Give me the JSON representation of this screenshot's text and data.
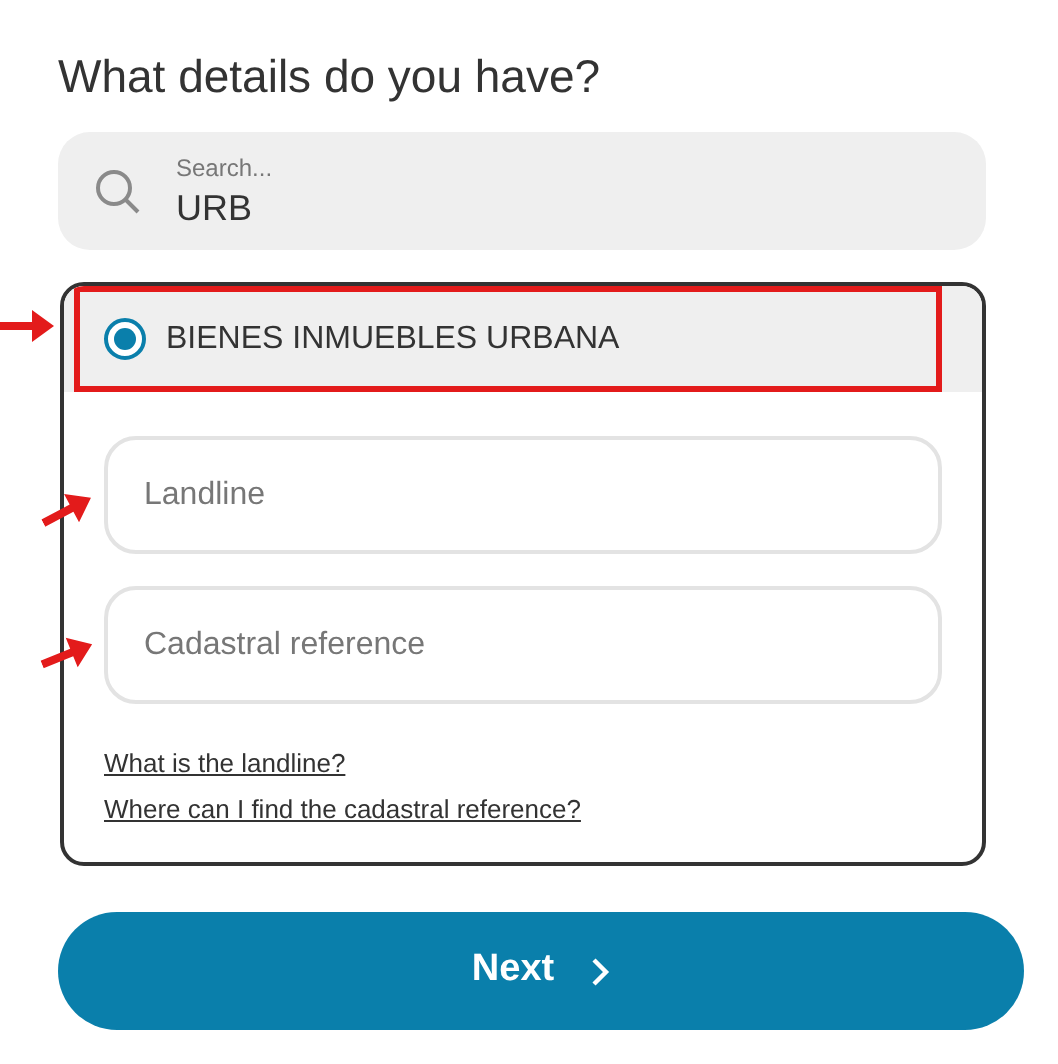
{
  "heading": "What details do you have?",
  "search": {
    "placeholder": "Search...",
    "value": "URB"
  },
  "option": {
    "label": "BIENES INMUEBLES URBANA",
    "selected": true,
    "highlighted": true
  },
  "fields": [
    {
      "placeholder": "Landline"
    },
    {
      "placeholder": "Cadastral reference"
    }
  ],
  "links": [
    "What is the landline?",
    "Where can I find the cadastral reference?"
  ],
  "next_button": {
    "label": "Next"
  }
}
